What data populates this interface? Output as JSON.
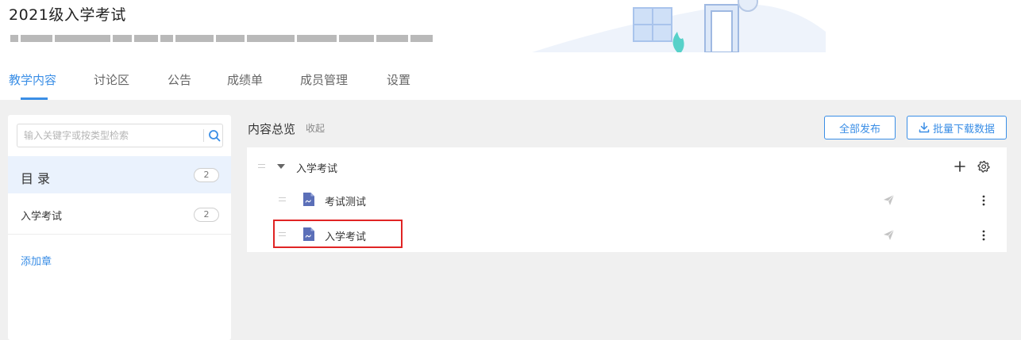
{
  "course": {
    "title": "2021级入学考试"
  },
  "tabs": [
    {
      "label": "教学内容",
      "active": true
    },
    {
      "label": "讨论区"
    },
    {
      "label": "公告"
    },
    {
      "label": "成绩单"
    },
    {
      "label": "成员管理"
    },
    {
      "label": "设置"
    }
  ],
  "sidebar": {
    "search_placeholder": "输入关键字或按类型检索",
    "toc_label": "目录",
    "toc_count": "2",
    "chapters": [
      {
        "label": "入学考试",
        "count": "2"
      }
    ],
    "add_chapter": "添加章"
  },
  "main": {
    "title": "内容总览",
    "collapse": "收起",
    "publish_all": "全部发布",
    "batch_download": "批量下载数据",
    "chapter": {
      "label": "入学考试",
      "items": [
        {
          "label": "考试测试",
          "icon": "quiz-doc-icon"
        },
        {
          "label": "入学考试",
          "icon": "quiz-doc-icon",
          "highlighted": true
        }
      ]
    }
  },
  "colors": {
    "accent": "#3a8ee6",
    "highlight_border": "#e02424",
    "toc_bg": "#eaf2fd"
  }
}
